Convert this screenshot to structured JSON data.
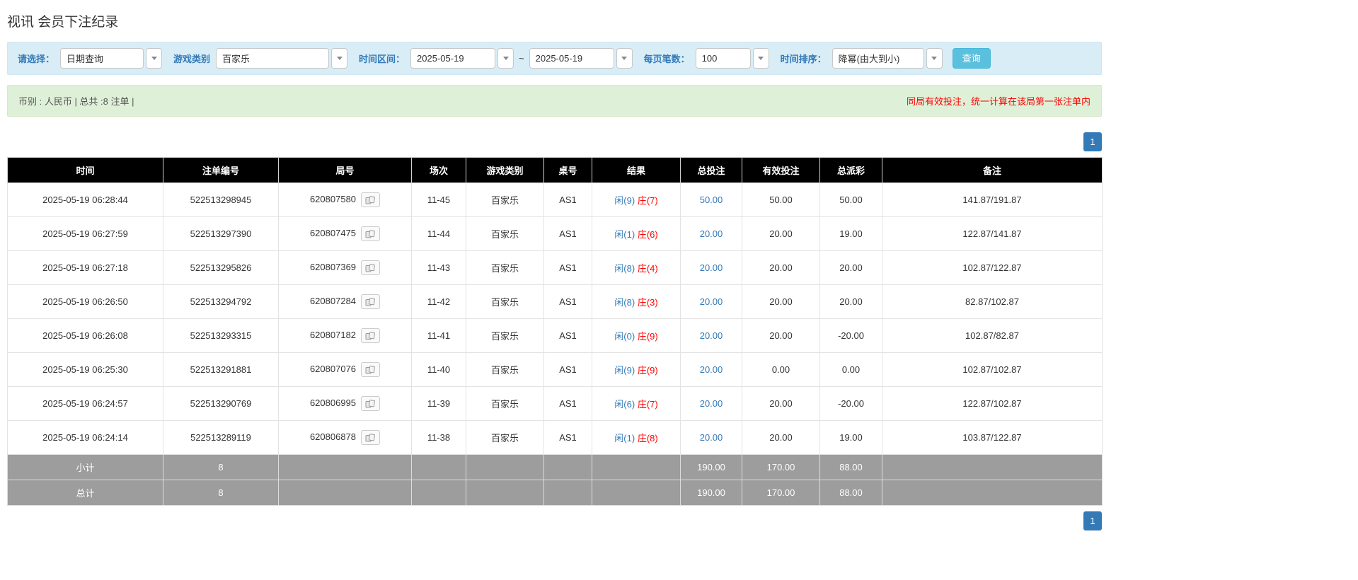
{
  "page": {
    "title": "视讯 会员下注纪录"
  },
  "filters": {
    "select_label": "请选择：",
    "select_value": "日期查询",
    "game_type_label": "游戏类别",
    "game_type_value": "百家乐",
    "time_range_label": "时间区间：",
    "date_from": "2025-05-19",
    "tilde": "~",
    "date_to": "2025-05-19",
    "page_size_label": "每页笔数：",
    "page_size_value": "100",
    "sort_label": "时间排序：",
    "sort_value": "降幂(由大到小)",
    "query_button": "查询"
  },
  "summary": {
    "left": "币别 : 人民币 | 总共 :8 注单 |",
    "right": "同局有效投注，统一计算在该局第一张注单内"
  },
  "pagination": {
    "page": "1"
  },
  "table": {
    "headers": [
      "时间",
      "注单编号",
      "局号",
      "场次",
      "游戏类别",
      "桌号",
      "结果",
      "总投注",
      "有效投注",
      "总派彩",
      "备注"
    ],
    "rows": [
      {
        "time": "2025-05-19 06:28:44",
        "bet_id": "522513298945",
        "round": "620807580",
        "session": "11-45",
        "game": "百家乐",
        "table_no": "AS1",
        "player": "闲(9)",
        "banker": "庄(7)",
        "total_bet": "50.00",
        "valid_bet": "50.00",
        "payout": "50.00",
        "remark": "141.87/191.87"
      },
      {
        "time": "2025-05-19 06:27:59",
        "bet_id": "522513297390",
        "round": "620807475",
        "session": "11-44",
        "game": "百家乐",
        "table_no": "AS1",
        "player": "闲(1)",
        "banker": "庄(6)",
        "total_bet": "20.00",
        "valid_bet": "20.00",
        "payout": "19.00",
        "remark": "122.87/141.87"
      },
      {
        "time": "2025-05-19 06:27:18",
        "bet_id": "522513295826",
        "round": "620807369",
        "session": "11-43",
        "game": "百家乐",
        "table_no": "AS1",
        "player": "闲(8)",
        "banker": "庄(4)",
        "total_bet": "20.00",
        "valid_bet": "20.00",
        "payout": "20.00",
        "remark": "102.87/122.87"
      },
      {
        "time": "2025-05-19 06:26:50",
        "bet_id": "522513294792",
        "round": "620807284",
        "session": "11-42",
        "game": "百家乐",
        "table_no": "AS1",
        "player": "闲(8)",
        "banker": "庄(3)",
        "total_bet": "20.00",
        "valid_bet": "20.00",
        "payout": "20.00",
        "remark": "82.87/102.87"
      },
      {
        "time": "2025-05-19 06:26:08",
        "bet_id": "522513293315",
        "round": "620807182",
        "session": "11-41",
        "game": "百家乐",
        "table_no": "AS1",
        "player": "闲(0)",
        "banker": "庄(9)",
        "total_bet": "20.00",
        "valid_bet": "20.00",
        "payout": "-20.00",
        "remark": "102.87/82.87"
      },
      {
        "time": "2025-05-19 06:25:30",
        "bet_id": "522513291881",
        "round": "620807076",
        "session": "11-40",
        "game": "百家乐",
        "table_no": "AS1",
        "player": "闲(9)",
        "banker": "庄(9)",
        "total_bet": "20.00",
        "valid_bet": "0.00",
        "payout": "0.00",
        "remark": "102.87/102.87"
      },
      {
        "time": "2025-05-19 06:24:57",
        "bet_id": "522513290769",
        "round": "620806995",
        "session": "11-39",
        "game": "百家乐",
        "table_no": "AS1",
        "player": "闲(6)",
        "banker": "庄(7)",
        "total_bet": "20.00",
        "valid_bet": "20.00",
        "payout": "-20.00",
        "remark": "122.87/102.87"
      },
      {
        "time": "2025-05-19 06:24:14",
        "bet_id": "522513289119",
        "round": "620806878",
        "session": "11-38",
        "game": "百家乐",
        "table_no": "AS1",
        "player": "闲(1)",
        "banker": "庄(8)",
        "total_bet": "20.00",
        "valid_bet": "20.00",
        "payout": "19.00",
        "remark": "103.87/122.87"
      }
    ],
    "subtotal": {
      "label": "小计",
      "count": "8",
      "total_bet": "190.00",
      "valid_bet": "170.00",
      "payout": "88.00"
    },
    "total": {
      "label": "总计",
      "count": "8",
      "total_bet": "190.00",
      "valid_bet": "170.00",
      "payout": "88.00"
    }
  }
}
